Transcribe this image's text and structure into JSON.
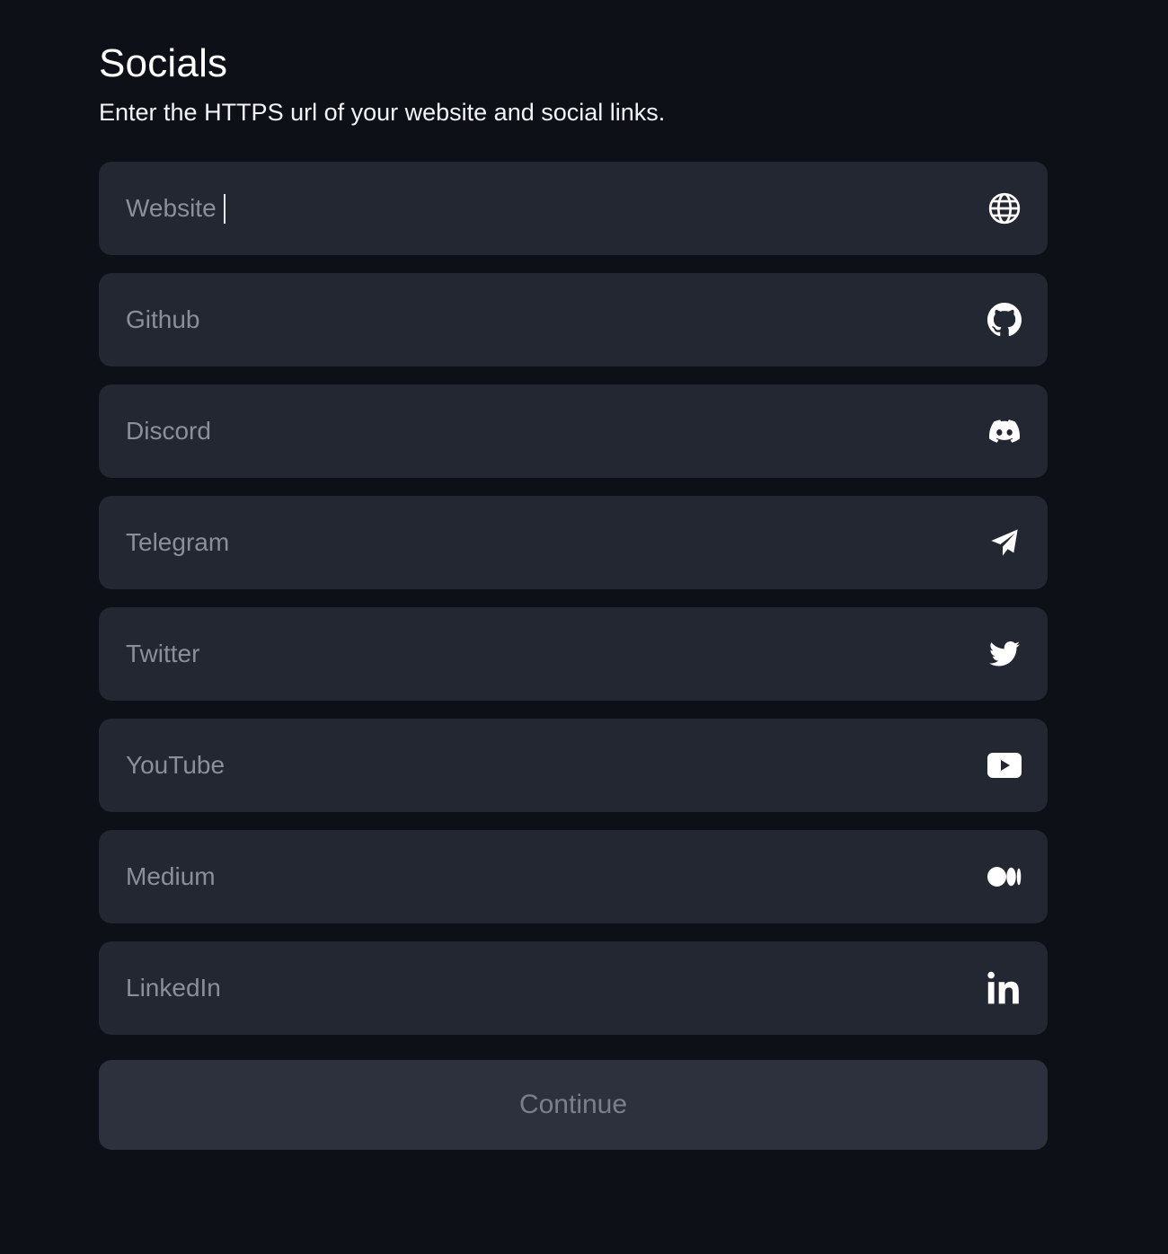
{
  "header": {
    "title": "Socials",
    "subtitle": "Enter the HTTPS url of your website and social links."
  },
  "fields": [
    {
      "placeholder": "Website",
      "value": "",
      "icon": "globe-icon",
      "focused": true
    },
    {
      "placeholder": "Github",
      "value": "",
      "icon": "github-icon"
    },
    {
      "placeholder": "Discord",
      "value": "",
      "icon": "discord-icon"
    },
    {
      "placeholder": "Telegram",
      "value": "",
      "icon": "telegram-icon"
    },
    {
      "placeholder": "Twitter",
      "value": "",
      "icon": "twitter-icon"
    },
    {
      "placeholder": "YouTube",
      "value": "",
      "icon": "youtube-icon"
    },
    {
      "placeholder": "Medium",
      "value": "",
      "icon": "medium-icon"
    },
    {
      "placeholder": "LinkedIn",
      "value": "",
      "icon": "linkedin-icon"
    }
  ],
  "continue_button": {
    "label": "Continue",
    "disabled": true
  },
  "colors": {
    "background": "#0d1016",
    "field_background": "#222731",
    "button_background": "#2d313d",
    "placeholder": "#8b8f99",
    "button_text": "#7b7f8b",
    "text": "#ffffff"
  }
}
